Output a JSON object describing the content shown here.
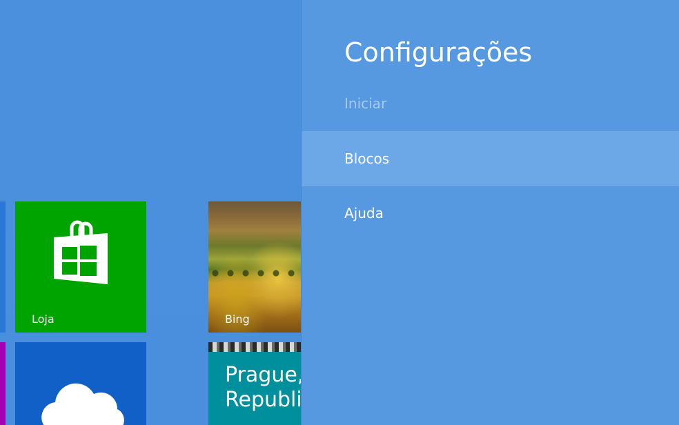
{
  "start_screen": {
    "tiles": {
      "store": {
        "label": "Loja",
        "color": "#00a400"
      },
      "bing": {
        "label": "Bing"
      },
      "onedrive": {
        "color": "#1060c8"
      },
      "travel": {
        "line1": "Prague,",
        "line2": "Republi",
        "color": "#008f9c"
      }
    }
  },
  "settings": {
    "title": "Configurações",
    "subtitle": "Iniciar",
    "items": [
      {
        "label": "Blocos",
        "selected": true
      },
      {
        "label": "Ajuda",
        "selected": false
      }
    ],
    "colors": {
      "panel": "#5699e1",
      "selected": "#6ca8e8"
    }
  }
}
